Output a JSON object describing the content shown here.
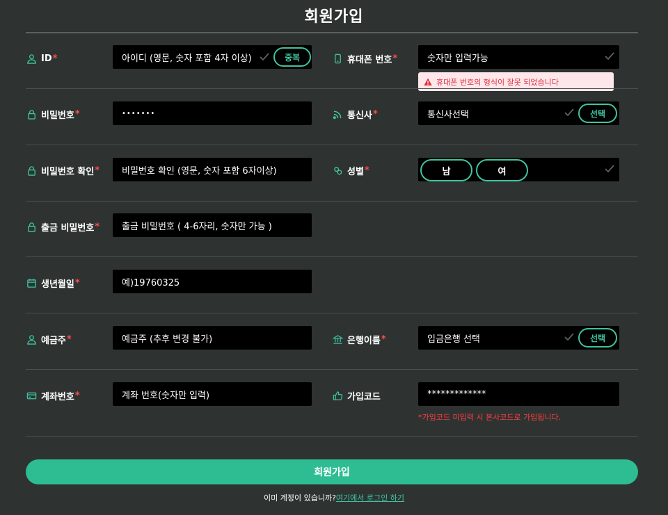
{
  "page": {
    "title": "회원가입",
    "required_mark": "*"
  },
  "colors": {
    "background": "#2e3332",
    "field": "#000000",
    "accent": "#3fc4a0",
    "submit": "#2ebd92",
    "required": "#ff4d4d",
    "error_bg": "#fde7ea",
    "error_text": "#e03040"
  },
  "form": {
    "id": {
      "label": "ID",
      "placeholder": "아이디 (영문, 숫자 포함 4자 이상)",
      "button": "중복",
      "icon": "user-icon"
    },
    "phone": {
      "label": "휴대폰 번호",
      "placeholder": "숫자만 입력가능",
      "icon": "mobile-icon",
      "error": "휴대폰 번호의 형식이 잘못 되었습니다"
    },
    "password": {
      "label": "비밀번호",
      "value": "•••••••",
      "icon": "lock-icon"
    },
    "carrier": {
      "label": "통신사",
      "value": "통신사선택",
      "button": "선택",
      "icon": "signal-icon"
    },
    "password_confirm": {
      "label": "비밀번호 확인",
      "placeholder": "비밀번호 확인 (영문, 숫자 포함 6자이상)",
      "icon": "lock-icon"
    },
    "gender": {
      "label": "성별",
      "options": [
        "남",
        "여"
      ],
      "icon": "gender-icon"
    },
    "withdraw_password": {
      "label": "출금 비밀번호",
      "placeholder": "출금 비밀번호 ( 4-6자리, 숫자만 가능 )",
      "icon": "lock-icon"
    },
    "birthdate": {
      "label": "생년월일",
      "placeholder": "예)19760325",
      "icon": "calendar-icon"
    },
    "depositor": {
      "label": "예금주",
      "placeholder": "예금주 (추후 변경 불가)",
      "icon": "user-icon"
    },
    "bank": {
      "label": "은행이름",
      "value": "입금은행 선택",
      "button": "선택",
      "icon": "bank-icon"
    },
    "account": {
      "label": "계좌번호",
      "placeholder": "계좌 번호(숫자만 입력)",
      "icon": "card-icon"
    },
    "signup_code": {
      "label": "가입코드",
      "value": "*************",
      "icon": "thumbs-up-icon",
      "note": "*가입코드 미입력 시 본사코드로 가입됩니다."
    }
  },
  "submit": {
    "label": "회원가입"
  },
  "footer": {
    "text": "이미 계정이 있습니까?",
    "link": "여기에서 로그인 하기"
  }
}
